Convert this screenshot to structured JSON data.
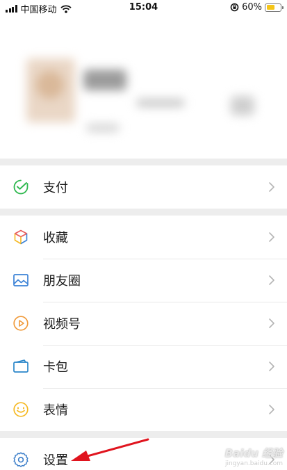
{
  "status_bar": {
    "carrier": "中国移动",
    "time": "15:04",
    "battery_percent_label": "60%",
    "battery_level": 0.6
  },
  "menu": {
    "pay": "支付",
    "favorites": "收藏",
    "moments": "朋友圈",
    "channels": "视频号",
    "cards": "卡包",
    "stickers": "表情",
    "settings": "设置"
  },
  "icons": {
    "pay": "wallet-check-icon",
    "favorites": "cube-icon",
    "moments": "image-icon",
    "channels": "play-circle-icon",
    "cards": "card-holder-icon",
    "stickers": "smiley-icon",
    "settings": "gear-icon",
    "chevron": "chevron-right-icon"
  },
  "colors": {
    "pay": "#2db74d",
    "moments": "#3b82d6",
    "channels": "#f09a3a",
    "cards": "#2a86c9",
    "stickers": "#f5b820",
    "settings": "#3b7ec9",
    "annotation_arrow": "#e0141e"
  },
  "watermark": {
    "brand": "Baidu 经验",
    "url": "jingyan.baidu.com"
  }
}
